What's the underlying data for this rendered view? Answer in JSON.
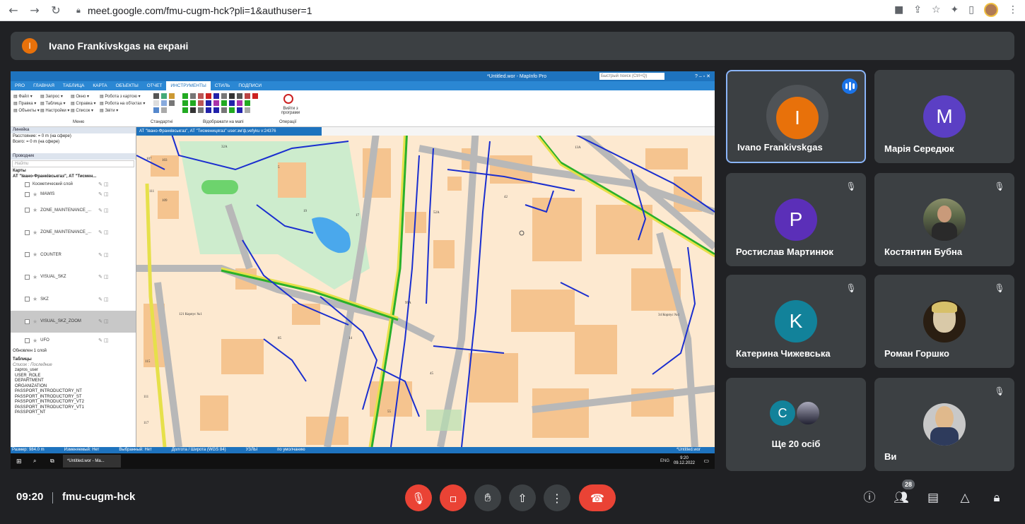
{
  "browser": {
    "url": "meet.google.com/fmu-cugm-hck?pli=1&authuser=1"
  },
  "presenting_banner": {
    "avatar_letter": "I",
    "text": "Ivano Frankivskgas на екрані"
  },
  "shared_screen": {
    "app_title": "*Untitled.wor - MapInfo Pro",
    "search_placeholder": "Быстрый поиск (Ctrl+Q)",
    "ribbon_tabs": [
      "PRO",
      "ГЛАВНАЯ",
      "ТАБЛИЦА",
      "КАРТА",
      "ОБЪЕКТЫ",
      "ОТЧЕТ",
      "ИНСТРУМЕНТЫ",
      "СТИЛЬ",
      "ПОДПИСИ"
    ],
    "ribbon_groups": [
      "Меню",
      "Стандартні",
      "Відображати на мапі",
      "Операції"
    ],
    "ribbon_exit": "Вийти з програми",
    "left_panel": {
      "ruler_title": "Линейка",
      "distance": "Расстояние: = 0 m (на сфере)",
      "total": "Всего: = 0 m (на сфере)",
      "explorer_title": "Проводник",
      "search": "Найти",
      "maps_header": "Карты",
      "map_name": "АТ \"Івано-Франківськгаз\", АТ \"Тисмен...",
      "layers": [
        "Косметический слой",
        "MAWIS",
        "ZONE_MAINTENANCE_...",
        "ZONE_MAINTENANCE_...",
        "COUNTER",
        "VISUAL_SKZ",
        "SKZ",
        "VISUAL_SKZ_ZOOM",
        "UFO"
      ],
      "updated": "Обновлен 1 слой",
      "tables_header": "Таблицы",
      "list_label": "Список : Последние",
      "tables": [
        "zapros_user",
        "USER_ROLE",
        "DEPARTMENT",
        "ORGANIZATION",
        "PASSPORT_INTRODUCTORY_NT",
        "PASSPORT_INTRODUCTORY_ST",
        "PASSPORT_INTRODUCTORY_VT2",
        "PASSPORT_INTRODUCTORY_VT1",
        "PASSPORT_NT"
      ]
    },
    "map_window_title": "АТ \"Івано-Франківськгаз\", АТ \"Тисменицягаз\" user:зм'ф,vefyku v:24376",
    "status": [
      "Размер: 984.0 m",
      "Изменяемый: Нет",
      "Выбранный: Нет",
      "Долгота / Широта (WGS 84)",
      "УЗЛЫ",
      "по умолчанию",
      "*Untitled.wor"
    ],
    "taskbar_app": "*Untitled.wor - Ma...",
    "taskbar_lang": "ENG",
    "taskbar_time": "9:20",
    "taskbar_date": "09.12.2022"
  },
  "participants": [
    {
      "name": "Ivano Frankivskgas",
      "letter": "I",
      "color": "#e8710a",
      "speaking": true
    },
    {
      "name": "Марія Середюк",
      "letter": "M",
      "color": "#5b3fc4",
      "muted": false
    },
    {
      "name": "Ростислав Мартинюк",
      "letter": "P",
      "color": "#5b2fb8",
      "muted": true
    },
    {
      "name": "Костянтин Бубна",
      "photo": true,
      "muted": true
    },
    {
      "name": "Катерина Чижевська",
      "letter": "K",
      "color": "#12829a",
      "muted": true
    },
    {
      "name": "Роман Горшко",
      "photo": true,
      "muted": true
    },
    {
      "name": "Ще 20 осіб",
      "letter": "C",
      "color": "#12829a"
    },
    {
      "name": "Ви",
      "photo": true,
      "muted": true
    }
  ],
  "bottom": {
    "time": "09:20",
    "meeting_code": "fmu-cugm-hck",
    "people_count": "28"
  },
  "icons": {
    "mic": "mic-off-icon",
    "camera": "camera-off-icon",
    "hand": "raise-hand-icon",
    "present": "present-icon",
    "more": "more-options-icon",
    "end": "end-call-icon",
    "info": "info-icon",
    "people": "people-icon",
    "chat": "chat-icon",
    "activities": "activities-icon",
    "host": "host-controls-icon"
  }
}
